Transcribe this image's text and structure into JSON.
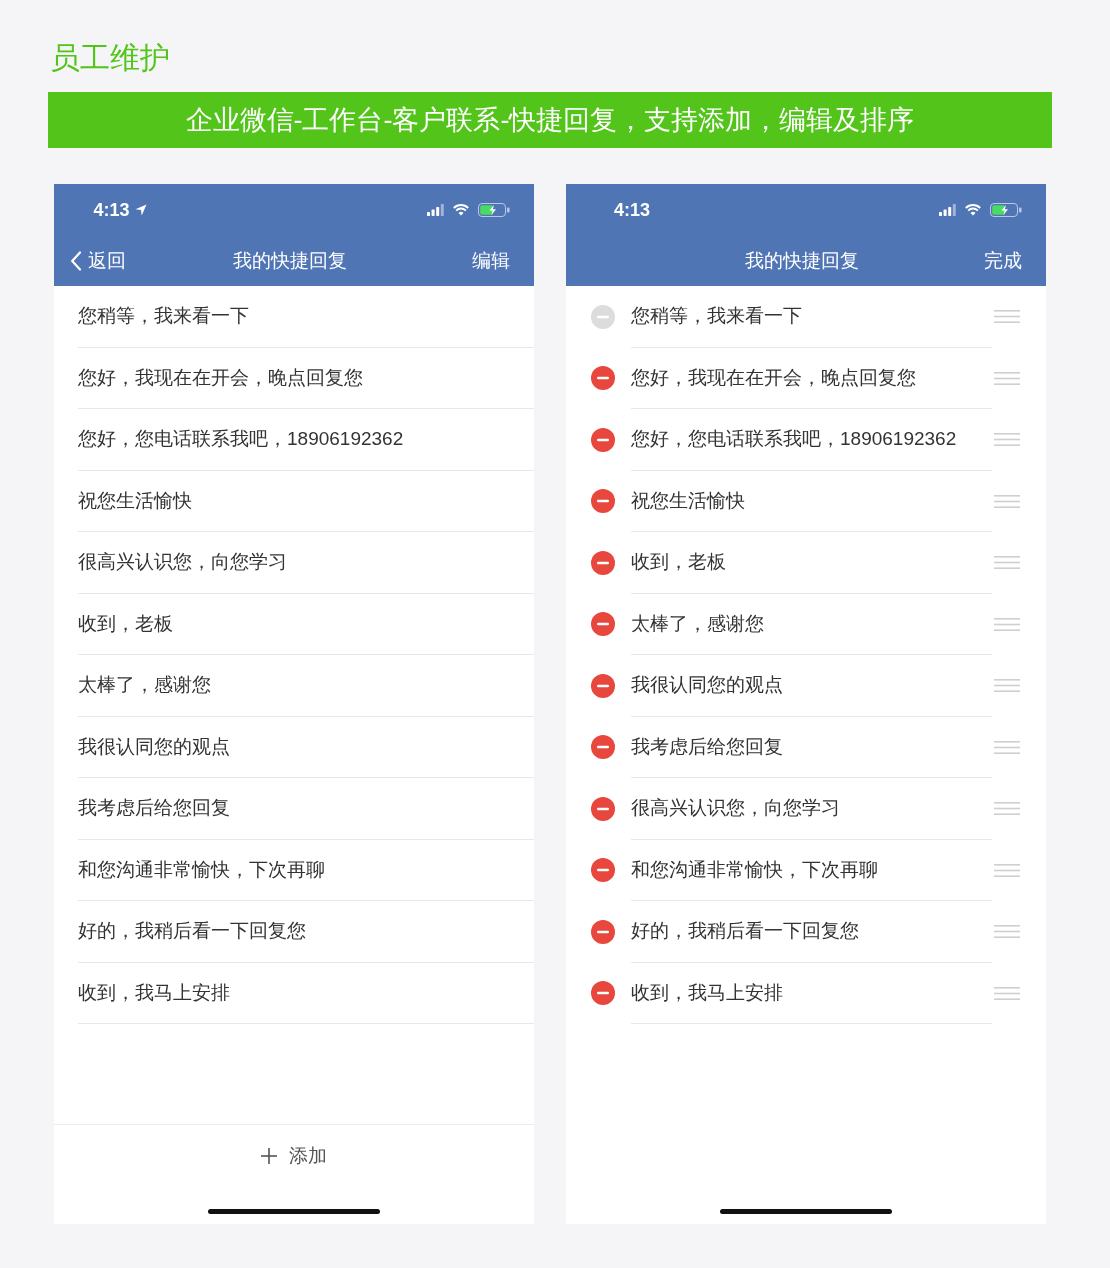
{
  "page_title": "员工维护",
  "banner": "企业微信-工作台-客户联系-快捷回复，支持添加，编辑及排序",
  "screens": [
    {
      "kind": "view",
      "status_bar": {
        "time": "4:13",
        "location": true
      },
      "nav": {
        "back": "返回",
        "title": "我的快捷回复",
        "action": "编辑"
      },
      "items": [
        {
          "text": "您稍等，我来看一下"
        },
        {
          "text": "您好，我现在在开会，晚点回复您"
        },
        {
          "text": "您好，您电话联系我吧，18906192362"
        },
        {
          "text": "祝您生活愉快"
        },
        {
          "text": "很高兴认识您，向您学习"
        },
        {
          "text": "收到，老板"
        },
        {
          "text": "太棒了，感谢您"
        },
        {
          "text": "我很认同您的观点"
        },
        {
          "text": "我考虑后给您回复"
        },
        {
          "text": "和您沟通非常愉快，下次再聊"
        },
        {
          "text": "好的，我稍后看一下回复您"
        },
        {
          "text": "收到，我马上安排"
        }
      ],
      "add_button": "添加"
    },
    {
      "kind": "edit",
      "status_bar": {
        "time": "4:13",
        "location": false
      },
      "nav": {
        "title": "我的快捷回复",
        "action": "完成"
      },
      "items": [
        {
          "text": "您稍等，我来看一下",
          "disabled": true
        },
        {
          "text": "您好，我现在在开会，晚点回复您",
          "disabled": false
        },
        {
          "text": "您好，您电话联系我吧，18906192362",
          "disabled": false
        },
        {
          "text": "祝您生活愉快",
          "disabled": false
        },
        {
          "text": "收到，老板",
          "disabled": false
        },
        {
          "text": "太棒了，感谢您",
          "disabled": false
        },
        {
          "text": "我很认同您的观点",
          "disabled": false
        },
        {
          "text": "我考虑后给您回复",
          "disabled": false
        },
        {
          "text": "很高兴认识您，向您学习",
          "disabled": false
        },
        {
          "text": "和您沟通非常愉快，下次再聊",
          "disabled": false
        },
        {
          "text": "好的，我稍后看一下回复您",
          "disabled": false
        },
        {
          "text": "收到，我马上安排",
          "disabled": false
        }
      ]
    }
  ]
}
